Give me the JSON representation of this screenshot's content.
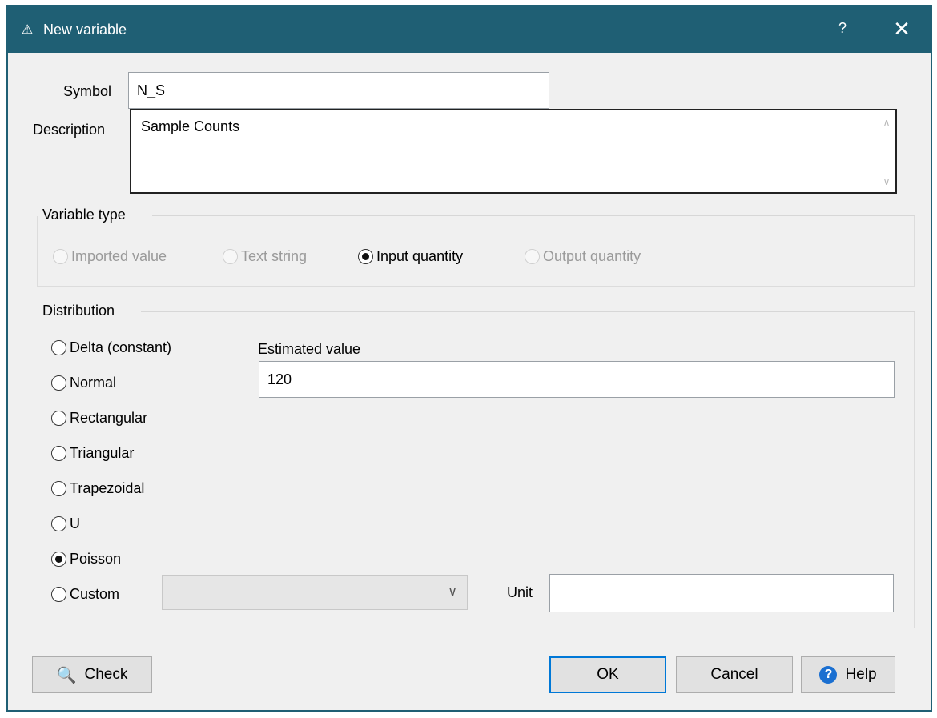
{
  "window": {
    "title": "New variable",
    "help_glyph": "?",
    "close_glyph": "✕"
  },
  "fields": {
    "symbol_label": "Symbol",
    "symbol_value": "N_S",
    "description_label": "Description",
    "description_value": "Sample Counts",
    "estimated_label": "Estimated value",
    "estimated_value": "120",
    "unit_label": "Unit",
    "unit_value": ""
  },
  "variable_type": {
    "title": "Variable type",
    "options": [
      {
        "label": "Imported value",
        "checked": false,
        "enabled": false
      },
      {
        "label": "Text string",
        "checked": false,
        "enabled": false
      },
      {
        "label": "Input quantity",
        "checked": true,
        "enabled": true
      },
      {
        "label": "Output quantity",
        "checked": false,
        "enabled": false
      }
    ]
  },
  "distribution": {
    "title": "Distribution",
    "options": [
      {
        "label": "Delta (constant)",
        "checked": false
      },
      {
        "label": "Normal",
        "checked": false
      },
      {
        "label": "Rectangular",
        "checked": false
      },
      {
        "label": "Triangular",
        "checked": false
      },
      {
        "label": "Trapezoidal",
        "checked": false
      },
      {
        "label": "U",
        "checked": false
      },
      {
        "label": "Poisson",
        "checked": true
      },
      {
        "label": "Custom",
        "checked": false
      }
    ],
    "custom_selected": ""
  },
  "buttons": {
    "check": "Check",
    "ok": "OK",
    "cancel": "Cancel",
    "help": "Help"
  },
  "icons": {
    "app": "app-icon",
    "check": "magnifier-icon",
    "help": "help-circle-icon"
  },
  "colors": {
    "titlebar": "#1f5f74",
    "default_button_border": "#0078d7",
    "help_icon": "#1a6fd1"
  }
}
